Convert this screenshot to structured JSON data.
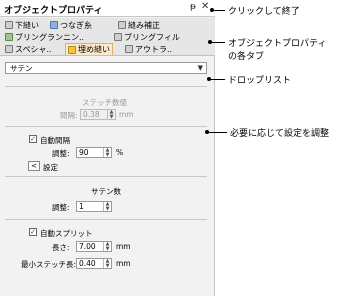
{
  "panel": {
    "title": "オブジェクトプロパティ",
    "pin_glyph": "ᵽ",
    "close_glyph": "✕",
    "tabs": [
      {
        "label": "下縫い"
      },
      {
        "label": "つなぎ糸"
      },
      {
        "label": "縫み補正"
      },
      {
        "label": "ブリングランニン.."
      },
      {
        "label": "ブリングフィル"
      },
      {
        "label": "スペシャ.."
      },
      {
        "label": "埋め縫い"
      },
      {
        "label": "アウトラ.."
      }
    ],
    "dropdown_value": "サテン",
    "stitch_section": {
      "header": "ステッチ数値",
      "spacing_label": "間隔:",
      "spacing_value": "0.38",
      "spacing_unit": "mm"
    },
    "auto_spacing": {
      "checkbox_label": "自動間隔",
      "checked": true,
      "adjust_label": "調整:",
      "adjust_value": "90",
      "adjust_unit": "%",
      "settings_button": "<",
      "settings_label": "設定"
    },
    "satin_count": {
      "header": "サテン数",
      "adjust_label": "調整:",
      "adjust_value": "1"
    },
    "auto_split": {
      "checkbox_label": "自動スプリット",
      "checked": true,
      "length_label": "長さ:",
      "length_value": "7.00",
      "length_unit": "mm",
      "min_label": "最小ステッチ長:",
      "min_value": "0.40",
      "min_unit": "mm"
    }
  },
  "annotations": {
    "close_note": "クリックして終了",
    "tabs_note_line1": "オブジェクトプロパティ",
    "tabs_note_line2": "の各タブ",
    "dropdown_note": "ドロップリスト",
    "settings_note": "必要に応じて設定を調整"
  }
}
